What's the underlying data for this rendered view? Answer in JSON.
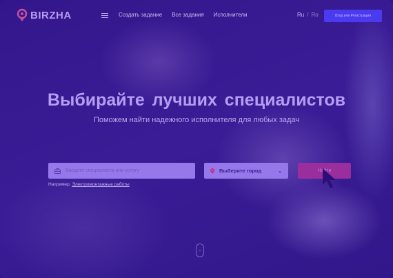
{
  "header": {
    "logo": "BIRZHA",
    "nav": [
      "Создать задание",
      "Все задания",
      "Исполнители"
    ],
    "lang": {
      "ru": "Ru",
      "separator": "/",
      "ro": "Ro"
    },
    "login_label": "Вход или Регистрация"
  },
  "hero": {
    "title": "Выбирайте  лучших специалистов",
    "subtitle": "Поможем найти надежного исполнителя для любых задач"
  },
  "search": {
    "placeholder": "Введите специалиста или услугу",
    "value": "",
    "city_label": "Выберите город",
    "find_label": "Найти",
    "example_prefix": "Например,",
    "example_link": "Электромонтажные работы"
  },
  "colors": {
    "accent": "#4a3af0",
    "find": "#9a2e9c",
    "logo": "#b99af0"
  }
}
